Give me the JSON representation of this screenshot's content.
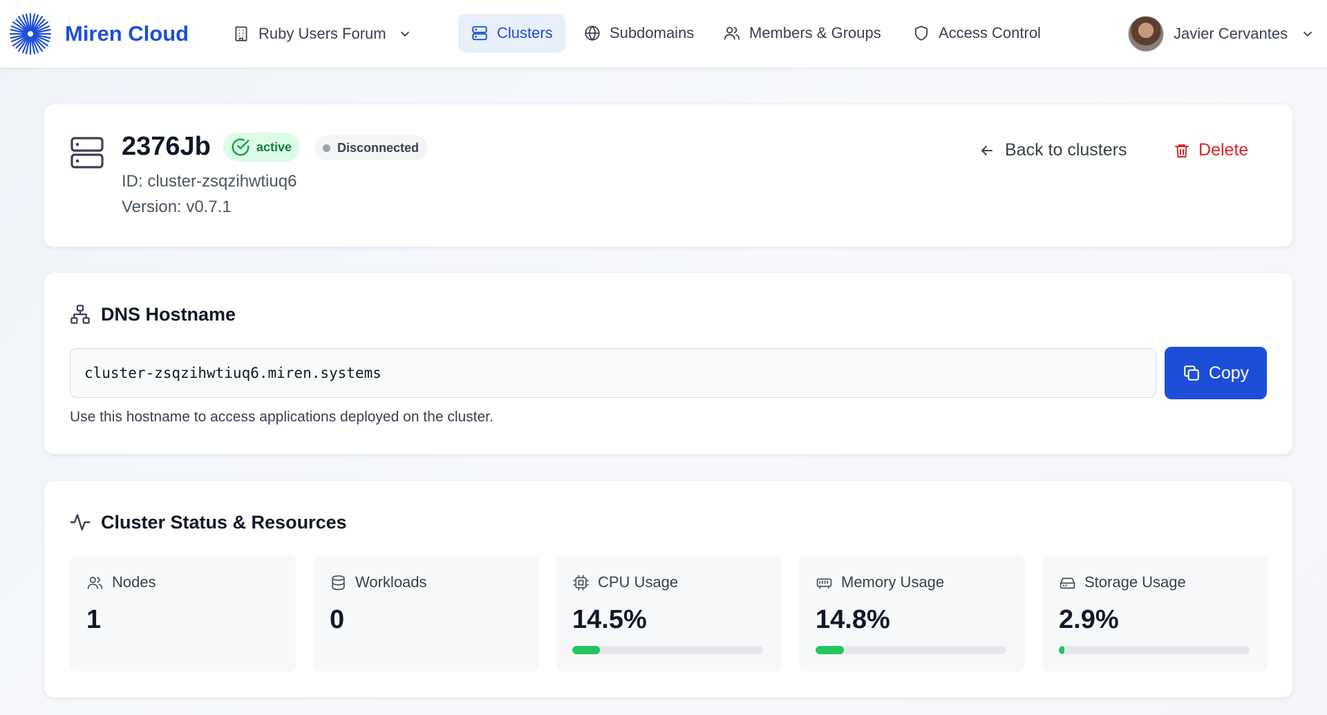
{
  "brand": {
    "name": "Miren Cloud"
  },
  "org": {
    "name": "Ruby Users Forum"
  },
  "nav": [
    {
      "label": "Clusters",
      "icon": "server-icon",
      "active": true
    },
    {
      "label": "Subdomains",
      "icon": "globe-icon",
      "active": false
    },
    {
      "label": "Members & Groups",
      "icon": "users-icon",
      "active": false
    },
    {
      "label": "Access Control",
      "icon": "shield-icon",
      "active": false
    }
  ],
  "user": {
    "name": "Javier Cervantes"
  },
  "cluster": {
    "name": "2376Jb",
    "status": "active",
    "connection": "Disconnected",
    "id_line": "ID: cluster-zsqzihwtiuq6",
    "version_line": "Version: v0.7.1",
    "back_label": "Back to clusters",
    "delete_label": "Delete"
  },
  "dns": {
    "title": "DNS Hostname",
    "hostname": "cluster-zsqzihwtiuq6.miren.systems",
    "copy_label": "Copy",
    "help": "Use this hostname to access applications deployed on the cluster."
  },
  "resources": {
    "title": "Cluster Status & Resources",
    "stats": [
      {
        "label": "Nodes",
        "value": "1",
        "icon": "users-icon"
      },
      {
        "label": "Workloads",
        "value": "0",
        "icon": "database-icon"
      },
      {
        "label": "CPU Usage",
        "value": "14.5%",
        "icon": "cpu-icon",
        "percent": 14.5
      },
      {
        "label": "Memory Usage",
        "value": "14.8%",
        "icon": "memory-icon",
        "percent": 14.8
      },
      {
        "label": "Storage Usage",
        "value": "2.9%",
        "icon": "hard-drive-icon",
        "percent": 2.9
      }
    ]
  },
  "colors": {
    "accent": "#1d4ed8",
    "active_badge_bg": "#dcfce7",
    "active_badge_text": "#15803d",
    "danger": "#dc2626",
    "progress": "#22c55e"
  }
}
